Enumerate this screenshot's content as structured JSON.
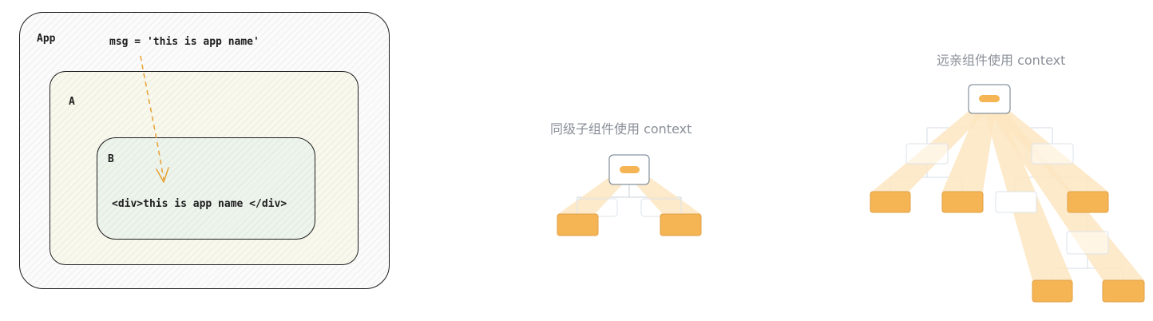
{
  "left_diagram": {
    "app_label": "App",
    "a_label": "A",
    "b_label": "B",
    "msg_code": "msg = 'this is app name'",
    "div_code": "<div>this is app name </div>"
  },
  "sibling_diagram": {
    "caption": "同级子组件使用 context"
  },
  "distant_diagram": {
    "caption": "远亲组件使用 context"
  },
  "colors": {
    "orange": "#f6b554",
    "orange_border": "#e0a045",
    "beam": "#fde6c2",
    "node_border": "#6a7a8a",
    "faint_line": "#d6dde6",
    "arrow": "#e8a030"
  }
}
